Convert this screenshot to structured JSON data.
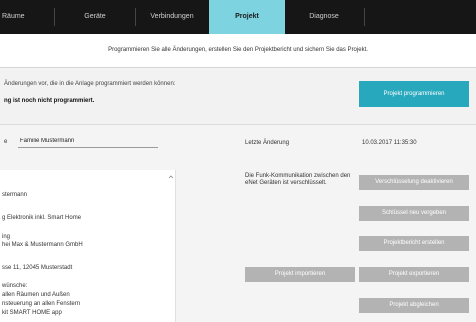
{
  "nav": {
    "tabs": [
      {
        "label": "Räume"
      },
      {
        "label": "Geräte"
      },
      {
        "label": "Verbindungen"
      },
      {
        "label": "Projekt"
      },
      {
        "label": "Diagnose"
      }
    ],
    "active_tab": "Projekt"
  },
  "subheader": {
    "text": "Programmieren Sie alle Änderungen, erstellen Sie den Projektbericht und sichern Sie das Projekt."
  },
  "program": {
    "hint": "Änderungen vor, die in die Anlage programmiert werden können:",
    "status": "ng ist noch nicht programmiert.",
    "button_label": "Projekt programmieren"
  },
  "project": {
    "name_label": "e",
    "name_value": "Familie Mustermann",
    "last_change_label": "Letzte Änderung",
    "last_change_value": "10.03.2017 11:35:30"
  },
  "details": {
    "lines": [
      "stermann",
      "g Elektronik inkl. Smart Home",
      "ing",
      "hei Max & Mustermann GmbH",
      "sse 11, 12045 Musterstadt",
      "wünsche:",
      "allen Räumen und Außen",
      "nsteuerung an allen Fenstern",
      "kit SMART HOME app"
    ]
  },
  "encryption": {
    "text": "Die Funk-Kommunikation zwischen den eNet Geräten ist verschlüsselt."
  },
  "buttons": {
    "disable_encryption": "Verschlüsselung deaktivieren",
    "reassign_key": "Schlüssel neu vergeben",
    "create_report": "Projektbericht erstellen",
    "import_project": "Projekt importieren",
    "export_project": "Projekt exportieren",
    "compare_project": "Projekt abgleichen"
  },
  "colors": {
    "nav_bg": "#161616",
    "active_tab": "#7ed3e0",
    "primary_button": "#28a8bd",
    "secondary_button": "#b3b3b3"
  },
  "icons": {
    "scroll_up": "chevron-up-icon"
  }
}
